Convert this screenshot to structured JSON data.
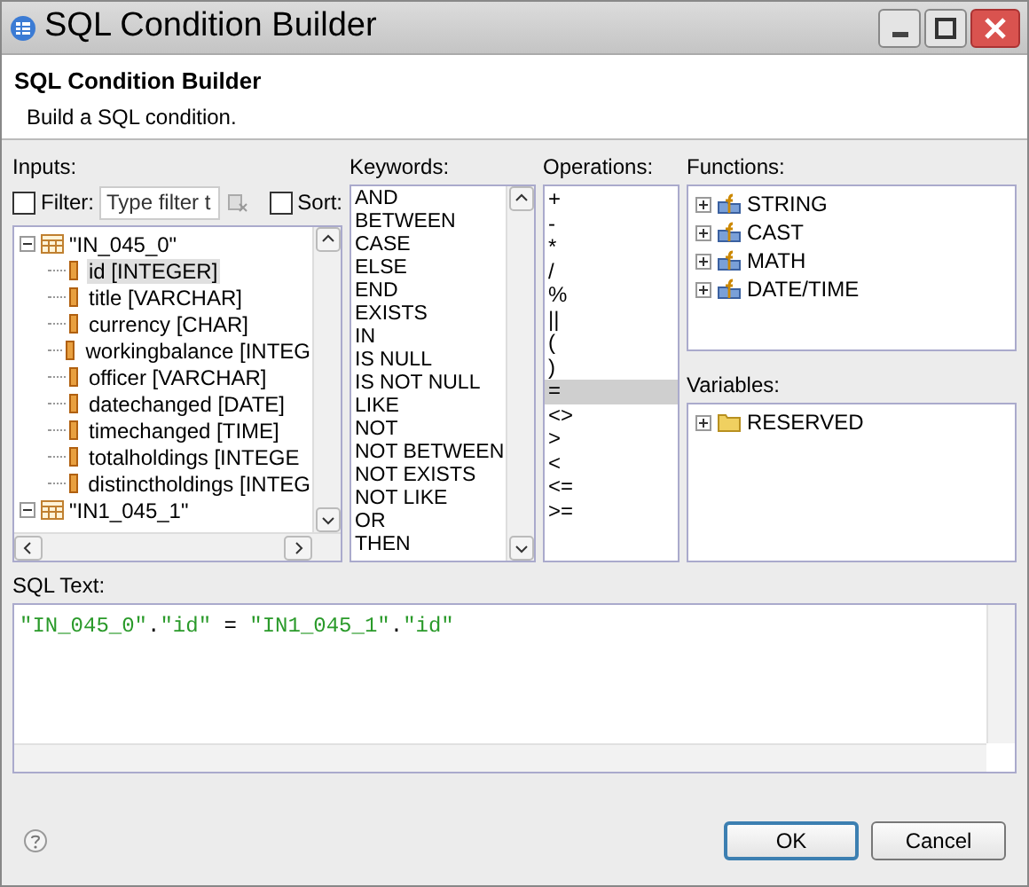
{
  "window": {
    "title": "SQL Condition Builder"
  },
  "header": {
    "title": "SQL Condition Builder",
    "description": "Build a SQL condition."
  },
  "inputs": {
    "label": "Inputs:",
    "filter": {
      "label": "Filter:",
      "checked": false,
      "placeholder": "Type filter t"
    },
    "sort": {
      "label": "Sort:",
      "checked": false
    },
    "tree": [
      {
        "label": "\"IN_045_0\"",
        "expanded": true,
        "children": [
          {
            "label": "id [INTEGER]",
            "selected": true
          },
          {
            "label": "title [VARCHAR]",
            "selected": false
          },
          {
            "label": "currency [CHAR]",
            "selected": false
          },
          {
            "label": "workingbalance [INTEG",
            "selected": false
          },
          {
            "label": "officer [VARCHAR]",
            "selected": false
          },
          {
            "label": "datechanged [DATE]",
            "selected": false
          },
          {
            "label": "timechanged [TIME]",
            "selected": false
          },
          {
            "label": "totalholdings [INTEGE",
            "selected": false
          },
          {
            "label": "distinctholdings [INTEG",
            "selected": false
          }
        ]
      },
      {
        "label": "\"IN1_045_1\"",
        "expanded": true
      }
    ]
  },
  "keywords": {
    "label": "Keywords:",
    "items": [
      "AND",
      "BETWEEN",
      "CASE",
      "ELSE",
      "END",
      "EXISTS",
      "IN",
      "IS NULL",
      "IS NOT NULL",
      "LIKE",
      "NOT",
      "NOT BETWEEN",
      "NOT EXISTS",
      "NOT LIKE",
      "OR",
      "THEN"
    ]
  },
  "operations": {
    "label": "Operations:",
    "items": [
      {
        "label": "+",
        "selected": false
      },
      {
        "label": "-",
        "selected": false
      },
      {
        "label": "*",
        "selected": false
      },
      {
        "label": "/",
        "selected": false
      },
      {
        "label": "%",
        "selected": false
      },
      {
        "label": "||",
        "selected": false
      },
      {
        "label": "(",
        "selected": false
      },
      {
        "label": ")",
        "selected": false
      },
      {
        "label": "=",
        "selected": true
      },
      {
        "label": "<>",
        "selected": false
      },
      {
        "label": ">",
        "selected": false
      },
      {
        "label": "<",
        "selected": false
      },
      {
        "label": "<=",
        "selected": false
      },
      {
        "label": ">=",
        "selected": false
      }
    ]
  },
  "functions": {
    "label": "Functions:",
    "items": [
      {
        "label": "STRING",
        "expanded": false
      },
      {
        "label": "CAST",
        "expanded": false
      },
      {
        "label": "MATH",
        "expanded": false
      },
      {
        "label": "DATE/TIME",
        "expanded": false
      }
    ]
  },
  "variables": {
    "label": "Variables:",
    "items": [
      {
        "label": "RESERVED",
        "expanded": false
      }
    ]
  },
  "sql": {
    "label": "SQL Text:",
    "tokens": [
      {
        "text": "\"IN_045_0\"",
        "kind": "string"
      },
      {
        "text": ".",
        "kind": "operator"
      },
      {
        "text": "\"id\"",
        "kind": "string"
      },
      {
        "text": " = ",
        "kind": "operator"
      },
      {
        "text": "\"IN1_045_1\"",
        "kind": "string"
      },
      {
        "text": ".",
        "kind": "operator"
      },
      {
        "text": "\"id\"",
        "kind": "string"
      }
    ]
  },
  "buttons": [
    {
      "label": "OK",
      "default": true
    },
    {
      "label": "Cancel",
      "default": false
    }
  ]
}
